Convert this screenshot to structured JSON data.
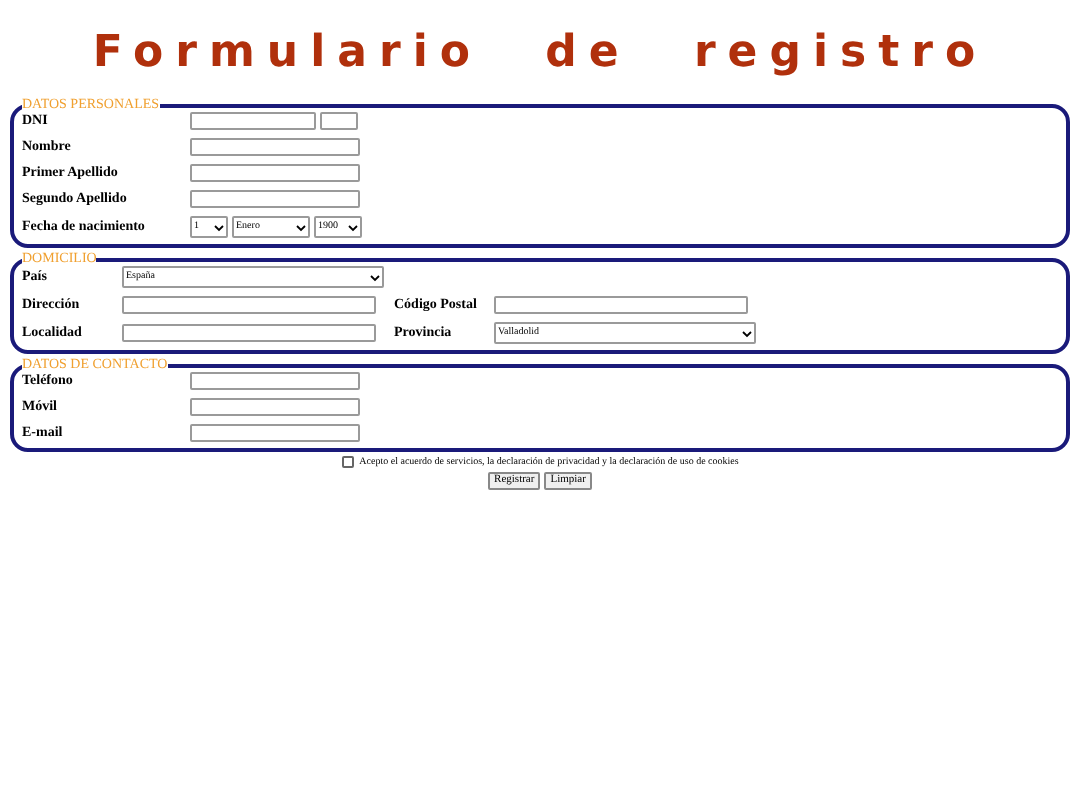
{
  "title": "Formulario de registro",
  "sections": [
    {
      "legend": "DATOS PERSONALES",
      "rows": [
        {
          "label": "DNI",
          "fields": [
            {
              "kind": "text"
            },
            {
              "kind": "text"
            }
          ]
        },
        {
          "label": "Nombre",
          "fields": [
            {
              "kind": "text"
            }
          ]
        },
        {
          "label": "Primer Apellido",
          "fields": [
            {
              "kind": "text"
            }
          ]
        },
        {
          "label": "Segundo Apellido",
          "fields": [
            {
              "kind": "text"
            }
          ]
        },
        {
          "label": "Fecha de nacimiento",
          "fields": [
            {
              "kind": "select",
              "value": "1"
            },
            {
              "kind": "select",
              "value": "Enero"
            },
            {
              "kind": "select",
              "value": "1900"
            }
          ]
        }
      ]
    },
    {
      "legend": "DOMICILIO",
      "rows": [
        {
          "label": "País",
          "fields": [
            {
              "kind": "select",
              "value": "España"
            }
          ]
        },
        {
          "label": "Dirección",
          "fields": [
            {
              "kind": "text"
            }
          ],
          "second": {
            "label": "Código Postal",
            "fields": [
              {
                "kind": "text"
              }
            ]
          }
        },
        {
          "label": "Localidad",
          "fields": [
            {
              "kind": "text"
            }
          ],
          "second": {
            "label": "Provincia",
            "fields": [
              {
                "kind": "select",
                "value": "Valladolid"
              }
            ]
          }
        }
      ]
    },
    {
      "legend": "DATOS DE CONTACTO",
      "rows": [
        {
          "label": "Teléfono",
          "fields": [
            {
              "kind": "text"
            }
          ]
        },
        {
          "label": "Móvil",
          "fields": [
            {
              "kind": "text"
            }
          ]
        },
        {
          "label": "E-mail",
          "fields": [
            {
              "kind": "text"
            }
          ]
        }
      ]
    }
  ],
  "terms": {
    "label": "Acepto el acuerdo de servicios, la declaración de privacidad y la declaración de uso de cookies",
    "checked": false
  },
  "buttons": [
    "Registrar",
    "Limpiar"
  ]
}
